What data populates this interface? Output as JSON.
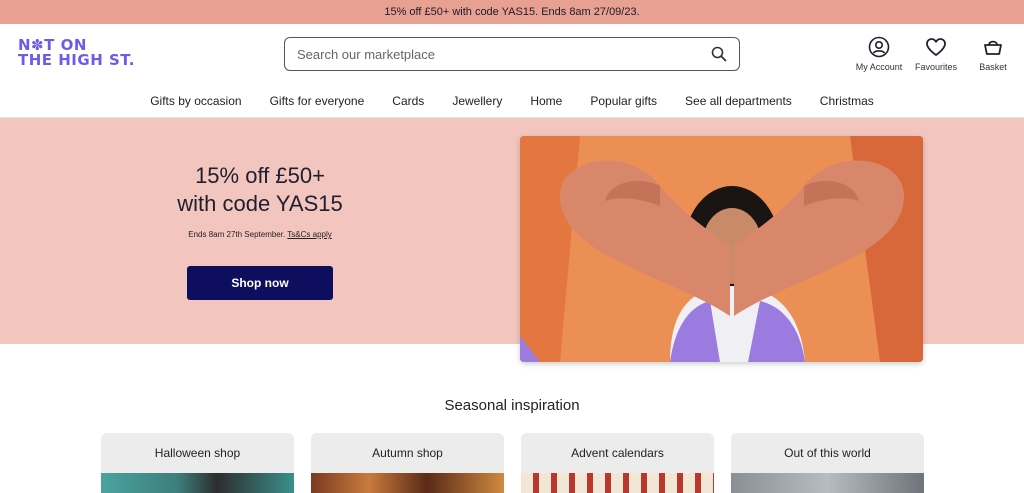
{
  "promo_bar": {
    "text": "15% off £50+ with code YAS15. Ends 8am 27/09/23."
  },
  "header": {
    "logo_line1": "N✽T ON",
    "logo_line2": "THE HIGH ST.",
    "search": {
      "placeholder": "Search our marketplace",
      "value": ""
    },
    "actions": {
      "account": "My Account",
      "favourites": "Favourites",
      "basket": "Basket"
    }
  },
  "nav": {
    "items": [
      "Gifts by occasion",
      "Gifts for everyone",
      "Cards",
      "Jewellery",
      "Home",
      "Popular gifts",
      "See all departments",
      "Christmas"
    ]
  },
  "hero": {
    "title_line1": "15% off £50+",
    "title_line2": "with code YAS15",
    "sub_text": "Ends 8am 27th September.",
    "sub_link": "Ts&Cs apply",
    "cta": "Shop now"
  },
  "seasonal": {
    "title": "Seasonal inspiration",
    "cards": [
      "Halloween shop",
      "Autumn shop",
      "Advent calendars",
      "Out of this world"
    ]
  },
  "colors": {
    "promo_bg": "#e8a090",
    "brand_purple": "#6c5ce7",
    "hero_bg": "#f2c6bf",
    "cta_bg": "#0d0e5e"
  },
  "icons": [
    "search-icon",
    "account-icon",
    "heart-icon",
    "basket-icon"
  ]
}
